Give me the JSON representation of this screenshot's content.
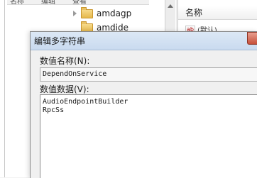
{
  "tree": {
    "top_clip": [
      "名称",
      "编辑",
      "查看"
    ],
    "items": [
      {
        "label": "amdagp"
      },
      {
        "label": "amdide"
      }
    ]
  },
  "list": {
    "column_name": "名称",
    "first_row_label": "(默认)"
  },
  "dialog": {
    "title": "编辑多字符串",
    "name_label": "数值名称(N):",
    "name_value": "DependOnService",
    "data_label": "数值数据(V):",
    "data_lines": [
      "AudioEndpointBuilder",
      "RpcSs"
    ]
  }
}
